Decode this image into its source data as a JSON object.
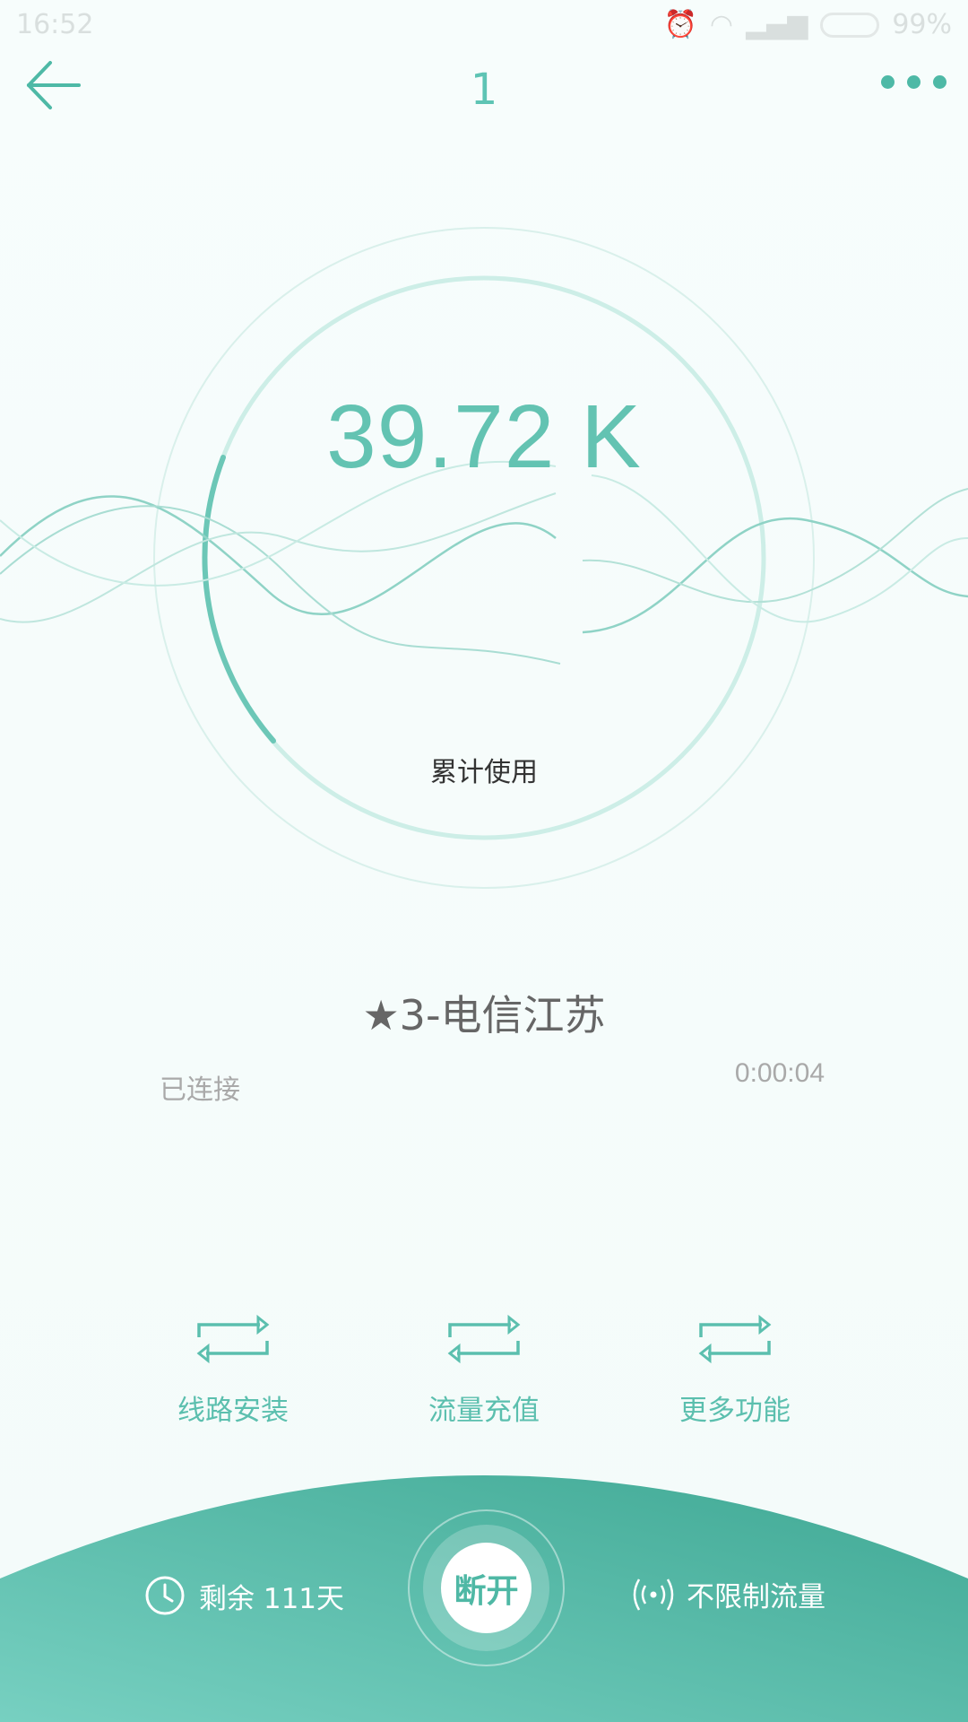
{
  "status_bar": {
    "time": "16:52",
    "battery": "99%"
  },
  "header": {
    "title": "1",
    "back_icon": "back-arrow-icon",
    "more_icon": "more-dots-icon"
  },
  "usage": {
    "value": "39.72 K",
    "label": "累计使用"
  },
  "server": {
    "name": "★3-电信江苏",
    "status": "已连接",
    "duration": "0:00:04"
  },
  "actions": [
    {
      "label": "线路安装",
      "icon": "swap-arrows-icon"
    },
    {
      "label": "流量充值",
      "icon": "swap-arrows-icon"
    },
    {
      "label": "更多功能",
      "icon": "swap-arrows-icon"
    }
  ],
  "bottom": {
    "remaining": "剩余 111天",
    "disconnect": "断开",
    "traffic": "不限制流量"
  },
  "colors": {
    "accent": "#5ec4b4",
    "bottom_gradient_start": "#77d0c1",
    "bottom_gradient_end": "#3fa894"
  }
}
